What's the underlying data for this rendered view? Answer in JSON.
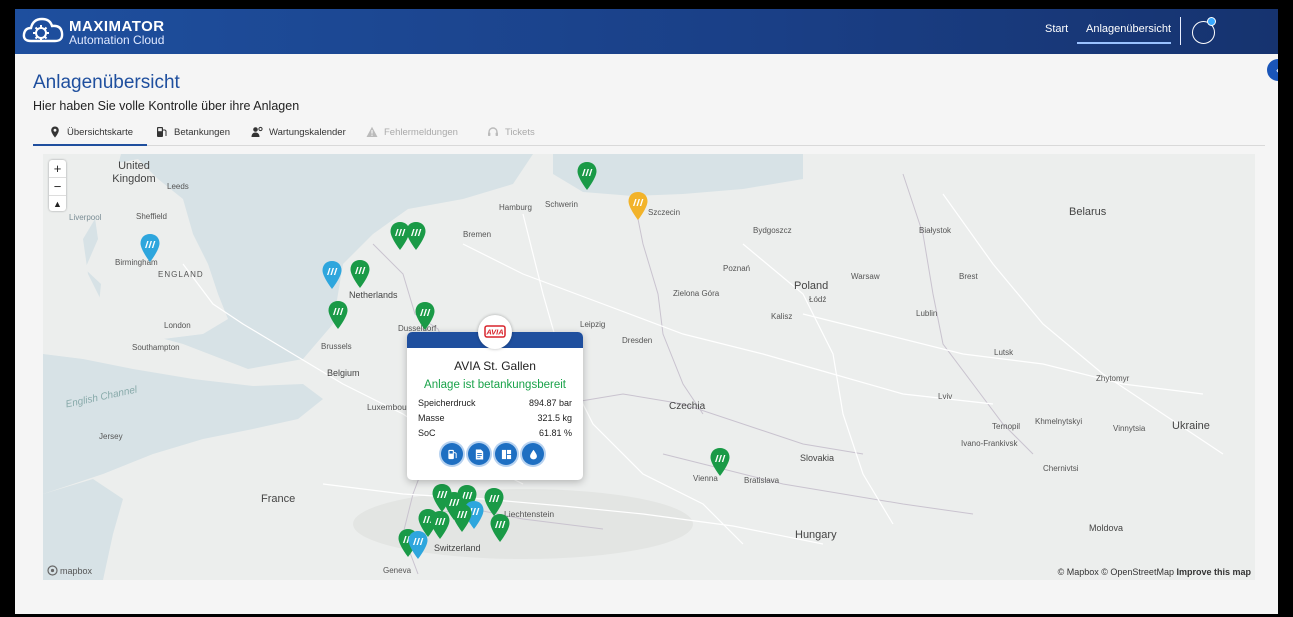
{
  "header": {
    "brand_name": "MAXIMATOR",
    "brand_sub": "Automation Cloud",
    "nav": [
      {
        "label": "Start"
      },
      {
        "label": "Anlagenübersicht"
      }
    ]
  },
  "page": {
    "title": "Anlagenübersicht",
    "subtitle": "Hier haben Sie volle Kontrolle über ihre Anlagen"
  },
  "tabs": [
    {
      "label": "Übersichtskarte",
      "icon": "map-pin-icon",
      "state": "active"
    },
    {
      "label": "Betankungen",
      "icon": "fuel-pump-icon",
      "state": "enabled"
    },
    {
      "label": "Wartungskalender",
      "icon": "user-gear-icon",
      "state": "enabled"
    },
    {
      "label": "Fehlermeldungen",
      "icon": "warning-icon",
      "state": "disabled"
    },
    {
      "label": "Tickets",
      "icon": "support-icon",
      "state": "disabled"
    }
  ],
  "map": {
    "zoom_in": "+",
    "zoom_out": "−",
    "reset": "▲",
    "mapbox_label": "mapbox",
    "attribution_mapbox": "© Mapbox",
    "attribution_osm": "© OpenStreetMap",
    "improve": "Improve this map",
    "labels": {
      "uk": "United Kingdom",
      "belarus": "Belarus",
      "poland": "Poland",
      "netherlands": "Netherlands",
      "belgium": "Belgium",
      "czechia": "Czechia",
      "slovakia": "Slovakia",
      "ukraine": "Ukraine",
      "france": "France",
      "hungary": "Hungary",
      "moldova": "Moldova",
      "switzerland": "Switzerland",
      "england": "ENGLAND",
      "english_channel": "English Channel",
      "luxembourg": "Luxembourg",
      "birmingham": "Birmingham",
      "london": "London",
      "brussels": "Brussels",
      "hamburg": "Hamburg",
      "warsaw": "Warsaw",
      "lodz": "Łódź",
      "poznan": "Poznań",
      "vienna": "Vienna",
      "bratislava": "Bratislava",
      "lutsk": "Lutsk",
      "lviv": "Lviv",
      "zhytomyr": "Zhytomyr",
      "leeds": "Leeds",
      "sheffield": "Sheffield",
      "liverpool": "Liverpool",
      "bremen": "Bremen",
      "schwerin": "Schwerin",
      "szczecin": "Szczecin",
      "bydgoszcz": "Bydgoszcz",
      "bialystok": "Białystok",
      "jersey": "Jersey",
      "southampton": "Southampton",
      "leipzig": "Leipzig",
      "dresden": "Dresden",
      "ternopil": "Ternopil",
      "khmelnytskyi": "Khmelnytskyi",
      "vinnytsia": "Vinnytsia",
      "geneva": "Geneva",
      "liechtenstein": "Liechtenstein",
      "duesseldorf": "Dusseldorf",
      "kalisz": "Kalisz",
      "lublin": "Lublin",
      "kolmnt": "Zielona Góra",
      "brest": "Brest",
      "ivano": "Ivano-Frankivsk",
      "chernivtsi": "Chernivtsi"
    },
    "pin_colors": {
      "ready": "#1a9a47",
      "warning": "#f2b32a",
      "info": "#2ea6dd"
    }
  },
  "popup": {
    "brand": "AVIA",
    "title": "AVIA St. Gallen",
    "status": "Anlage ist betankungsbereit",
    "rows": [
      {
        "key": "Speicherdruck",
        "value": "894.87 bar"
      },
      {
        "key": "Masse",
        "value": "321.5 kg"
      },
      {
        "key": "SoC",
        "value": "61.81 %"
      }
    ],
    "buttons": [
      "fuel-pump-icon",
      "document-icon",
      "dashboard-icon",
      "drop-icon"
    ]
  }
}
